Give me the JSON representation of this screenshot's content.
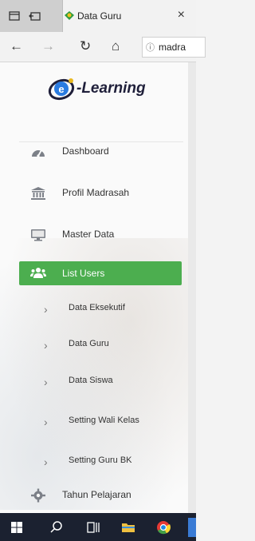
{
  "browser": {
    "tab_title": "Data Guru",
    "tab_close": "×",
    "url_text": "madra",
    "url_info": "ⓘ",
    "nav": {
      "back": "←",
      "forward": "→",
      "refresh": "↻",
      "home": "⌂"
    }
  },
  "logo": {
    "text": "-Learning"
  },
  "sidebar": {
    "items": [
      {
        "label": "Dashboard",
        "icon": "speedometer-icon"
      },
      {
        "label": "Profil Madrasah",
        "icon": "institution-icon"
      },
      {
        "label": "Master Data",
        "icon": "monitor-icon"
      },
      {
        "label": "List Users",
        "icon": "users-icon",
        "active": true
      }
    ],
    "sub_items": [
      {
        "label": "Data Eksekutif"
      },
      {
        "label": "Data Guru"
      },
      {
        "label": "Data Siswa"
      },
      {
        "label": "Setting Wali Kelas"
      },
      {
        "label": "Setting Guru BK"
      }
    ],
    "bottom_item": {
      "label": "Tahun Pelajaran",
      "icon": "gear-icon"
    },
    "sub_chevron": "›"
  },
  "colors": {
    "active_bg": "#4cae4f",
    "taskbar": "#1b2130"
  }
}
